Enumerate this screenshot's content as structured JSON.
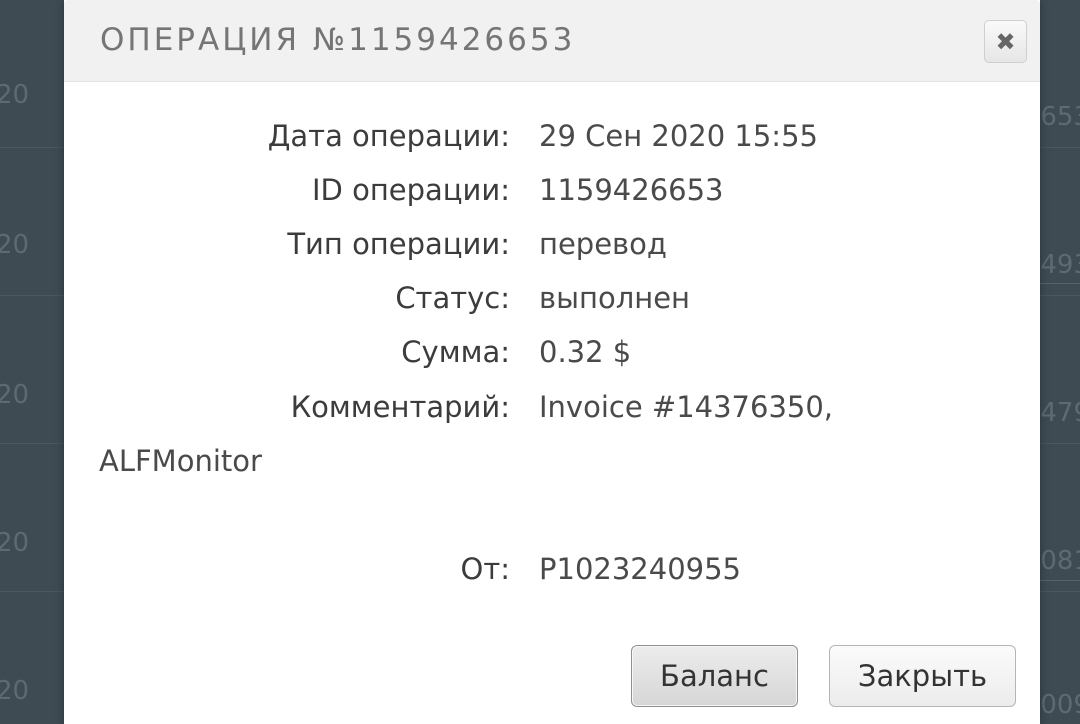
{
  "background": {
    "left_fragments": [
      "20",
      "20",
      "20",
      "20",
      "20"
    ],
    "right_fragments": [
      "653",
      "493",
      "479",
      "081",
      "009"
    ]
  },
  "dialog": {
    "title": "ОПЕРАЦИЯ №1159426653",
    "close_icon": "close-x",
    "fields": {
      "date_label": "Дата операции:",
      "date_value": "29 Сен 2020 15:55",
      "id_label": "ID операции:",
      "id_value": "1159426653",
      "type_label": "Тип операции:",
      "type_value": "перевод",
      "status_label": "Статус:",
      "status_value": "выполнен",
      "amount_label": "Сумма:",
      "amount_value": "0.32 $",
      "comment_label": "Комментарий:",
      "comment_value_line1": "Invoice #14376350,",
      "comment_value_line2": "ALFMonitor",
      "from_label": "От:",
      "from_value": "P1023240955"
    },
    "buttons": {
      "balance": "Баланс",
      "close": "Закрыть"
    }
  }
}
